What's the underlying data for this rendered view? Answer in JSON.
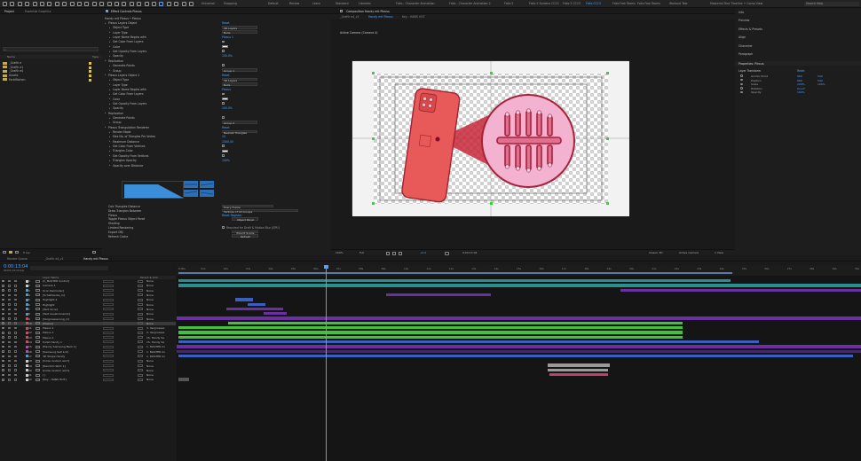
{
  "toolbar": {
    "workspaces": [
      "Default",
      "Review",
      "Learn",
      "Standard",
      "Libraries",
      "Folio - Character Animation",
      "Folio - Character Animation 2",
      "Folio 2",
      "Folio 2 Screens CC13",
      "Folio 3 CC13",
      "Folio CC13",
      "Folio Fast Teams",
      "Folio Fast Teams",
      "Workout Text",
      "Masterial Text Timeline + Comp View"
    ],
    "active_workspace_index": 10,
    "search_placeholder": "Search Help",
    "universal_label": "Universal",
    "snapping_label": "Snapping"
  },
  "project": {
    "tabs": [
      "Project",
      "Essential Graphics"
    ],
    "search_placeholder": "ρ",
    "columns": {
      "name": "Name",
      "type": "Type"
    },
    "items": [
      "_Grafik e",
      "_Grafik e1",
      "_Grafik e4",
      "Assets",
      "Farbflächen"
    ]
  },
  "effect_controls": {
    "tab_label": "Effect Controls Plexus",
    "breadcrumb": "Handy mit Plexus • Plexus",
    "rows": [
      {
        "label": "Plexus Layers Object",
        "value": "Reset",
        "kind": "blue",
        "indent": 1
      },
      {
        "label": "Object Type",
        "value": "3D Layers",
        "kind": "select",
        "indent": 2
      },
      {
        "label": "Layer Type",
        "value": "Nulls",
        "kind": "select",
        "indent": 2
      },
      {
        "label": "Layer Name Begins with",
        "value": "Plexus 1",
        "kind": "blue",
        "indent": 2
      },
      {
        "label": "Get Color From Layers",
        "value": "",
        "kind": "check",
        "indent": 2
      },
      {
        "label": "Color",
        "value": "",
        "kind": "swatch",
        "indent": 2
      },
      {
        "label": "Get Opacity From Layers",
        "value": "",
        "kind": "check",
        "indent": 2
      },
      {
        "label": "Opacity",
        "value": "100.0%",
        "kind": "blue",
        "indent": 2
      },
      {
        "label": "Replication",
        "value": "",
        "kind": "none",
        "indent": 1
      },
      {
        "label": "Generate Points",
        "value": "",
        "kind": "check",
        "indent": 2
      },
      {
        "label": "Group",
        "value": "Group 1",
        "kind": "select",
        "indent": 2
      },
      {
        "label": "Plexus Layers Object 2",
        "value": "Reset",
        "kind": "blue",
        "indent": 1
      },
      {
        "label": "Object Type",
        "value": "3D Layers",
        "kind": "select",
        "indent": 2
      },
      {
        "label": "Layer Type",
        "value": "Nulls",
        "kind": "select",
        "indent": 2
      },
      {
        "label": "Layer Name Begins with",
        "value": "Plexus",
        "kind": "blue",
        "indent": 2
      },
      {
        "label": "Get Color From Layers",
        "value": "",
        "kind": "check",
        "indent": 2
      },
      {
        "label": "Color",
        "value": "",
        "kind": "swatch",
        "indent": 2
      },
      {
        "label": "Get Opacity From Layers",
        "value": "",
        "kind": "check",
        "indent": 2
      },
      {
        "label": "Opacity",
        "value": "100.0%",
        "kind": "blue",
        "indent": 2
      },
      {
        "label": "Replication",
        "value": "",
        "kind": "none",
        "indent": 1
      },
      {
        "label": "Generate Points",
        "value": "",
        "kind": "check",
        "indent": 2
      },
      {
        "label": "Group",
        "value": "Group 2",
        "kind": "select",
        "indent": 2
      },
      {
        "label": "Plexus Triangulation Renderer",
        "value": "Reset",
        "kind": "blue",
        "indent": 1
      },
      {
        "label": "Render Mode",
        "value": "Nearest Triangles",
        "kind": "select",
        "indent": 2
      },
      {
        "label": "Max No. of Triangles Per Vertex",
        "value": "10",
        "kind": "blue",
        "indent": 2
      },
      {
        "label": "Maximum Distance",
        "value": "1000.00",
        "kind": "blue",
        "indent": 2
      },
      {
        "label": "Get Color From Vertices",
        "value": "",
        "kind": "check",
        "indent": 2
      },
      {
        "label": "Triangles Color",
        "value": "",
        "kind": "swatch",
        "indent": 2
      },
      {
        "label": "Get Opacity From Vertices",
        "value": "",
        "kind": "check",
        "indent": 2
      },
      {
        "label": "Triangles Opacity",
        "value": "100%",
        "kind": "blue",
        "indent": 2
      },
      {
        "label": "Opacity over Distance",
        "value": "",
        "kind": "none",
        "indent": 2
      }
    ],
    "lower_rows": [
      {
        "label": "Calc Triangles Distance",
        "value": "Every Frame",
        "kind": "select"
      },
      {
        "label": "Draw Triangles Between",
        "value": "Vertices of All Groups",
        "kind": "select"
      },
      {
        "label": "Plexus",
        "value": "Reset   Register",
        "kind": "blue"
      },
      {
        "label": "Toggle Plexus Object Panel",
        "value": "Object Panel",
        "kind": "button"
      },
      {
        "label": "Shading",
        "value": "",
        "kind": "none"
      },
      {
        "label": "Limited Rendering",
        "value": "Required for Draft & Motion Blur (GPU)",
        "kind": "check"
      },
      {
        "label": "Export OBJ",
        "value": "Export Scene",
        "kind": "button"
      },
      {
        "label": "Refresh Cache",
        "value": "Refresh",
        "kind": "button"
      }
    ]
  },
  "composition": {
    "tab_label": "Composition Handy mit Plexus",
    "subtabs": [
      "_Grafik e4_v1",
      "Handy mit Plexus",
      "Key - HANS HOT"
    ],
    "view_label": "Active Camera (Camera 4)",
    "bottom_bar": [
      "100%",
      "Full",
      "0:00:13:04",
      "Classic 3D",
      "Active Camera",
      "1 View"
    ],
    "render_label": "+0.0"
  },
  "right_panel": {
    "items": [
      "Info",
      "Preview",
      "Effects & Presets",
      "Align",
      "Character",
      "Paragraph"
    ],
    "properties_title": "Properties: Plexus",
    "layer_transform": "Layer Transform",
    "reset_label": "Reset",
    "props": [
      {
        "label": "Anchor Point",
        "v1": "960",
        "v2": "540"
      },
      {
        "label": "Position",
        "v1": "960",
        "v2": "540"
      },
      {
        "label": "Scale",
        "v1": "100%",
        "v2": "100%"
      },
      {
        "label": "Rotation",
        "v1": "0x+0°",
        "v2": ""
      },
      {
        "label": "Opacity",
        "v1": "100%",
        "v2": ""
      }
    ]
  },
  "timeline": {
    "tabs": [
      "Render Queue",
      "_Grafik e4_v1",
      "Handy mit Plexus"
    ],
    "timecode": "0:00:13:04",
    "fps_info": "00304 (25.00 fps)",
    "columns": {
      "layer_name": "Layer Name",
      "parent": "Parent & Link"
    },
    "ruler": [
      "0:00s",
      "01s",
      "02s",
      "03s",
      "04s",
      "05s",
      "06s",
      "07s",
      "08s",
      "09s",
      "10s",
      "11s",
      "12s",
      "13s",
      "14s",
      "15s",
      "16s",
      "17s",
      "18s",
      "19s",
      "20s",
      "21s",
      "22s",
      "23s",
      "24s",
      "25s",
      "26s",
      "27s",
      "28s",
      "29s",
      "30s"
    ],
    "layers": [
      {
        "num": "1",
        "name": "[C_MASTER Control]",
        "color": "#c8c8c8",
        "parent": "None"
      },
      {
        "num": "2",
        "name": "Camera 1",
        "color": "#c8c8c8",
        "parent": "None"
      },
      {
        "num": "3",
        "name": "[Icon Reminder]",
        "color": "#3aa0e0",
        "parent": "None"
      },
      {
        "num": "4",
        "name": "[Schaltwerke_m]",
        "color": "#3aa0e0",
        "parent": "None"
      },
      {
        "num": "5",
        "name": "Highlight 2",
        "color": "#3aa0e0",
        "parent": "None"
      },
      {
        "num": "6",
        "name": "Highlight",
        "color": "#3aa0e0",
        "parent": "None"
      },
      {
        "num": "7",
        "name": "[Text Sicre]",
        "color": "#3aa0e0",
        "parent": "None"
      },
      {
        "num": "8",
        "name": "[Text Ausstromendo]",
        "color": "#3aa0e0",
        "parent": "None"
      },
      {
        "num": "9",
        "name": "[Vergroesserung_m]",
        "color": "#e04060",
        "parent": "None"
      },
      {
        "num": "10",
        "name": "[Plexus]",
        "color": "#e04060",
        "parent": "None"
      },
      {
        "num": "11",
        "name": "Plexus 1",
        "color": "#e04060",
        "parent": "3. Vergroesse"
      },
      {
        "num": "12",
        "name": "Plexus 1",
        "color": "#e04060",
        "parent": "3. Vergroesse"
      },
      {
        "num": "13",
        "name": "Plexus 1",
        "color": "#e04060",
        "parent": "15. Handy Sa"
      },
      {
        "num": "14",
        "name": "Punkt Handy 1",
        "color": "#e04060",
        "parent": "15. Handy Sa"
      },
      {
        "num": "15",
        "name": "[Handy Samsung Back 1]",
        "color": "#c040c0",
        "parent": "1. MASTER Co"
      },
      {
        "num": "16",
        "name": "[Samsung Seit 1/2]",
        "color": "#c040c0",
        "parent": "1. MASTER Co"
      },
      {
        "num": "17",
        "name": "3D Shape Handy",
        "color": "#3aa0e0",
        "parent": "1. MASTER Co"
      },
      {
        "num": "18",
        "name": "[Inlde random wort]",
        "color": "#c8c8c8",
        "parent": "None"
      },
      {
        "num": "19",
        "name": "[Random Wort 1]",
        "color": "#c8c8c8",
        "parent": "None"
      },
      {
        "num": "20",
        "name": "[Inlde random wort]",
        "color": "#c8c8c8",
        "parent": "None"
      },
      {
        "num": "21",
        "name": "[ ]",
        "color": "#c8c8c8",
        "parent": "None"
      },
      {
        "num": "22",
        "name": "[Key - HANS HOT]",
        "color": "#c8c8c8",
        "parent": "None"
      }
    ]
  },
  "colors": {
    "accent": "#4da3ff",
    "bar_cyan": "#2a8f8f",
    "bar_purple": "#6a2fa0",
    "bar_blue": "#3a5fc0",
    "bar_green": "#45c03a",
    "bar_darkpurple": "#4a2080",
    "bar_grey": "#9a9a9a",
    "bar_pink": "#c04070",
    "phone_red": "#e85a5a",
    "magnifier_pink": "#f0a0c8"
  }
}
